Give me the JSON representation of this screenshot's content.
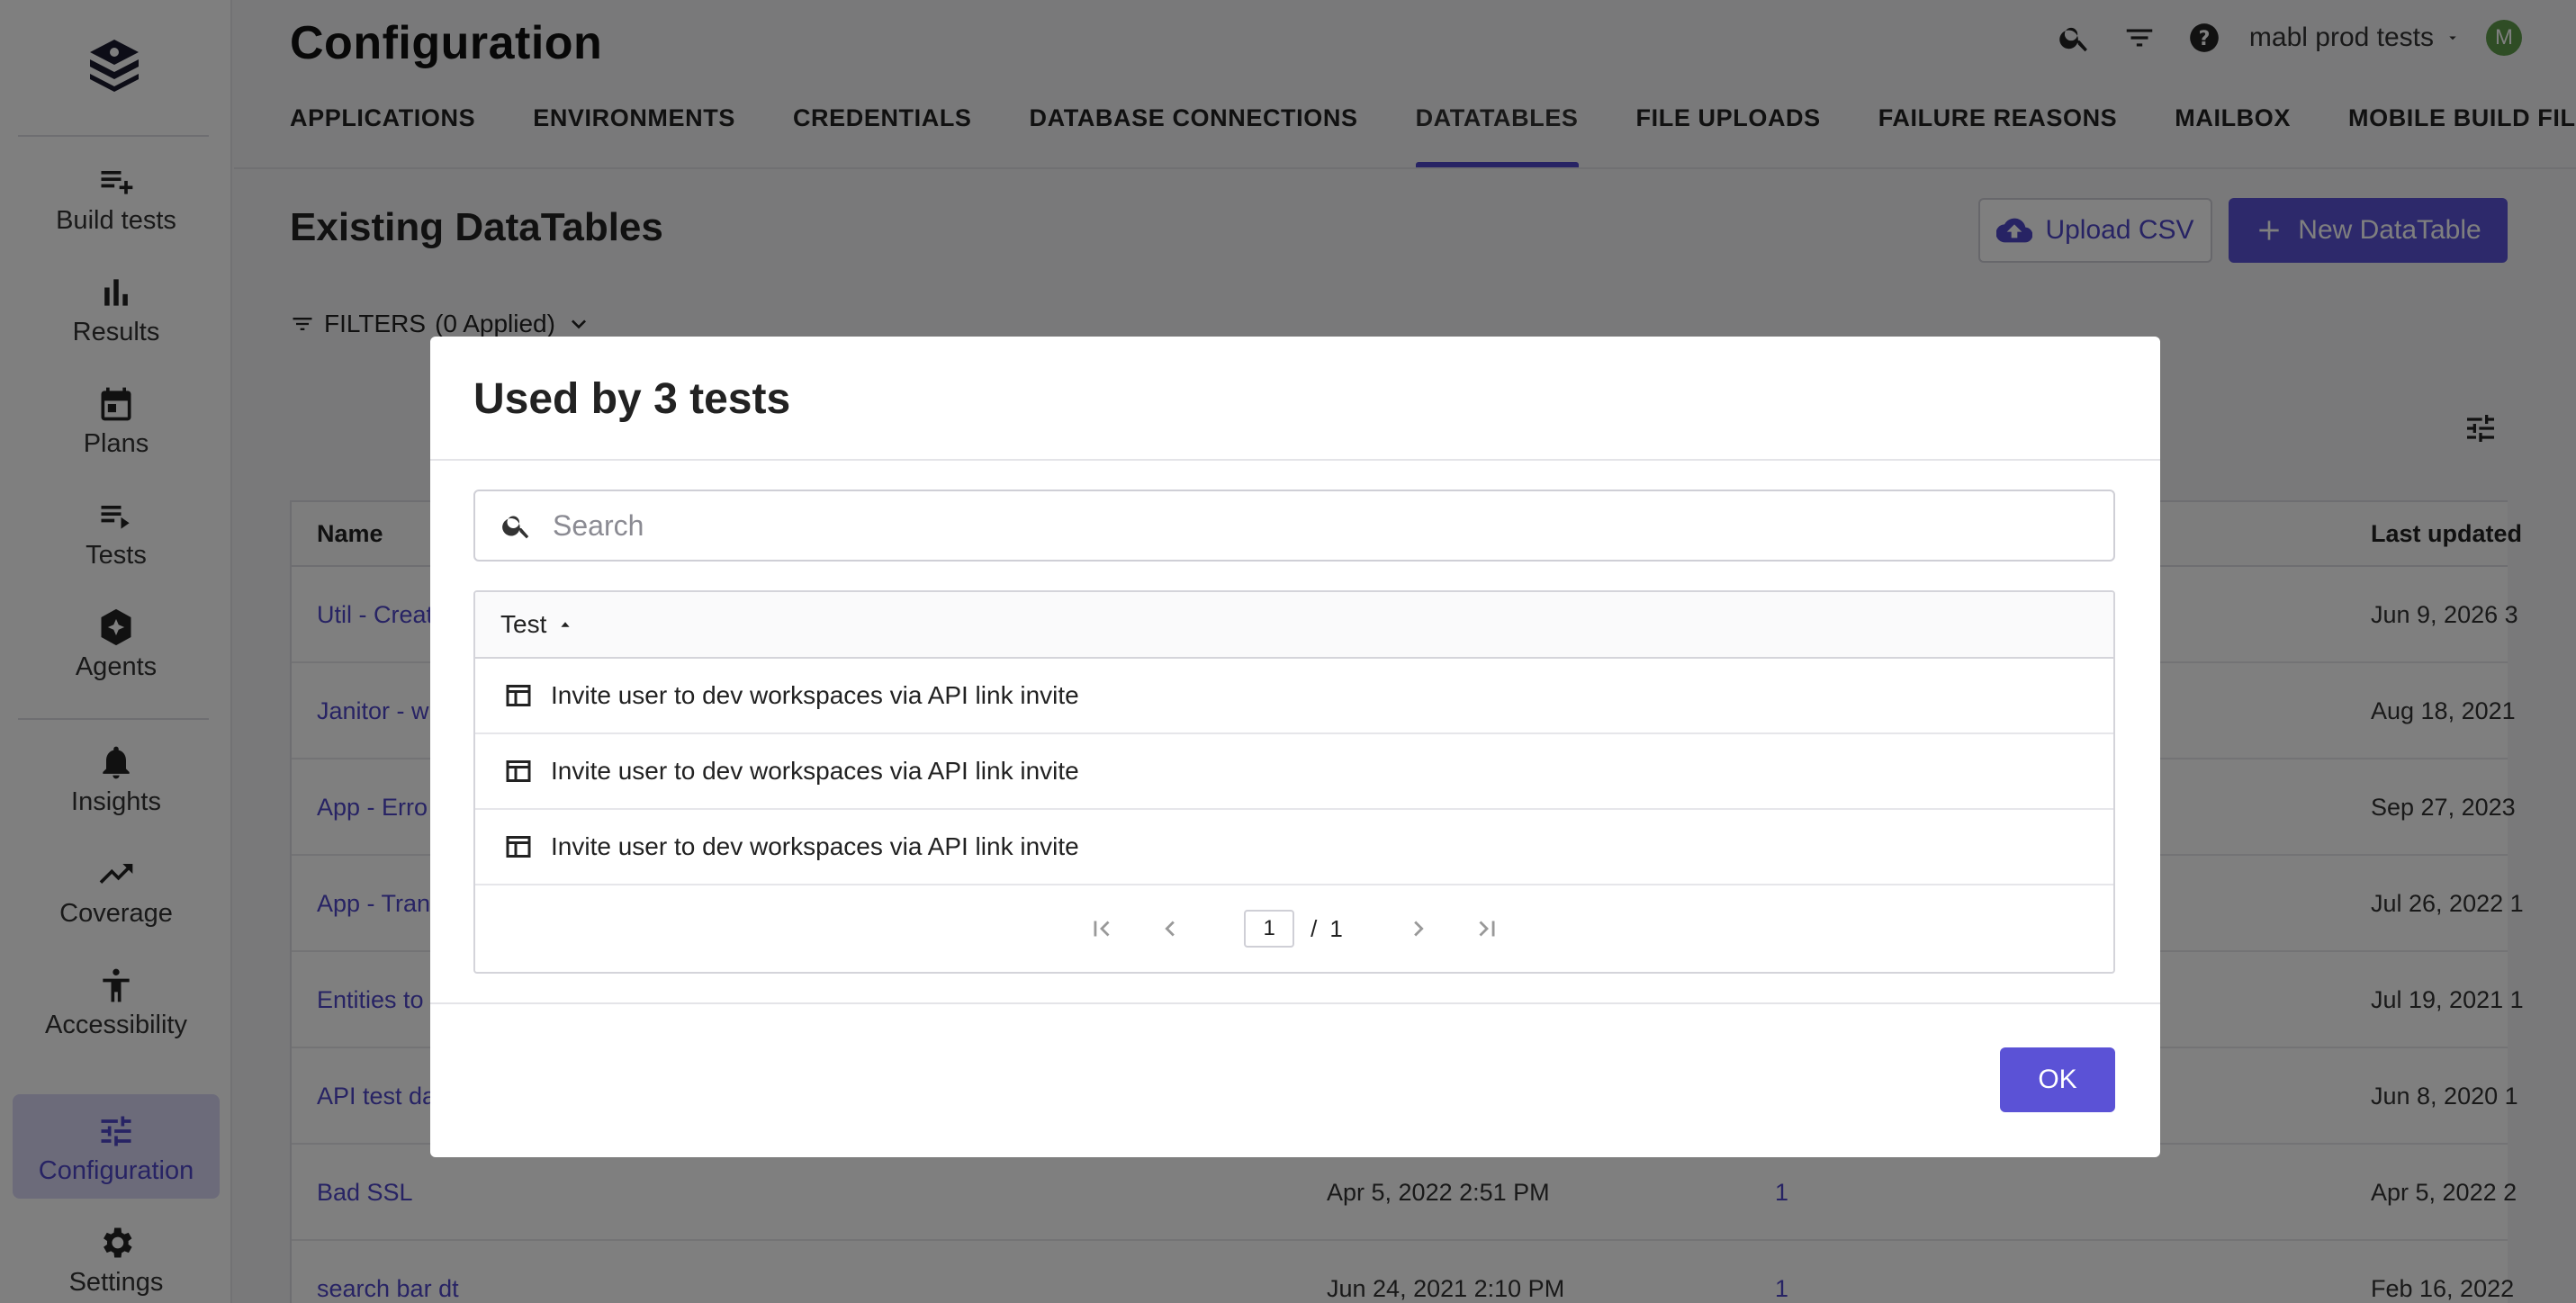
{
  "sidebar": {
    "items": [
      {
        "label": "Build tests",
        "icon": "playlist-add-icon"
      },
      {
        "label": "Results",
        "icon": "bar-chart-icon"
      },
      {
        "label": "Plans",
        "icon": "calendar-icon"
      },
      {
        "label": "Tests",
        "icon": "playlist-play-icon"
      },
      {
        "label": "Agents",
        "icon": "agent-badge-icon"
      },
      {
        "label": "Insights",
        "icon": "bell-icon"
      },
      {
        "label": "Coverage",
        "icon": "trending-up-icon"
      },
      {
        "label": "Accessibility",
        "icon": "accessibility-icon"
      },
      {
        "label": "Configuration",
        "icon": "tune-icon",
        "active": true
      },
      {
        "label": "Settings",
        "icon": "gear-icon"
      }
    ]
  },
  "header": {
    "title": "Configuration",
    "workspace": "mabl prod tests",
    "avatar_initial": "M",
    "tabs": [
      {
        "label": "APPLICATIONS"
      },
      {
        "label": "ENVIRONMENTS"
      },
      {
        "label": "CREDENTIALS"
      },
      {
        "label": "DATABASE CONNECTIONS"
      },
      {
        "label": "DATATABLES",
        "active": true
      },
      {
        "label": "FILE UPLOADS"
      },
      {
        "label": "FAILURE REASONS"
      },
      {
        "label": "MAILBOX"
      },
      {
        "label": "MOBILE BUILD FILES"
      }
    ]
  },
  "main": {
    "section_title": "Existing DataTables",
    "upload_label": "Upload CSV",
    "new_label": "New DataTable",
    "filters_label": "FILTERS",
    "filters_applied": "(0 Applied)",
    "columns": {
      "name": "Name",
      "last_updated": "Last updated"
    },
    "rows": [
      {
        "name": "Util - Creat",
        "created": "",
        "used_by": "",
        "updated": "Jun 9, 2026 3"
      },
      {
        "name": "Janitor - w",
        "created": "",
        "used_by": "",
        "updated": "Aug 18, 2021"
      },
      {
        "name": "App - Erro",
        "created": "",
        "used_by": "",
        "updated": "Sep 27, 2023"
      },
      {
        "name": "App - Tran",
        "created": "",
        "used_by": "",
        "updated": "Jul 26, 2022 1"
      },
      {
        "name": "Entities to",
        "created": "",
        "used_by": "",
        "updated": "Jul 19, 2021 1"
      },
      {
        "name": "API test da",
        "created": "",
        "used_by": "",
        "updated": "Jun 8, 2020 1"
      },
      {
        "name": "Bad SSL",
        "created": "Apr 5, 2022 2:51 PM",
        "used_by": "1",
        "updated": "Apr 5, 2022 2"
      },
      {
        "name": "search bar dt",
        "created": "Jun 24, 2021 2:10 PM",
        "used_by": "1",
        "updated": "Feb 16, 2022"
      }
    ]
  },
  "modal": {
    "title": "Used by 3 tests",
    "search_placeholder": "Search",
    "column_test": "Test",
    "tests": [
      {
        "name": "Invite user to dev workspaces via API link invite"
      },
      {
        "name": "Invite user to dev workspaces via API link invite"
      },
      {
        "name": "Invite user to dev workspaces via API link invite"
      }
    ],
    "pagination": {
      "current": "1",
      "separator": "/",
      "total": "1"
    },
    "ok_label": "OK"
  },
  "colors": {
    "accent": "#5b52d6",
    "link": "#4f46c8",
    "overlay": "rgba(0,0,0,0.5)"
  }
}
